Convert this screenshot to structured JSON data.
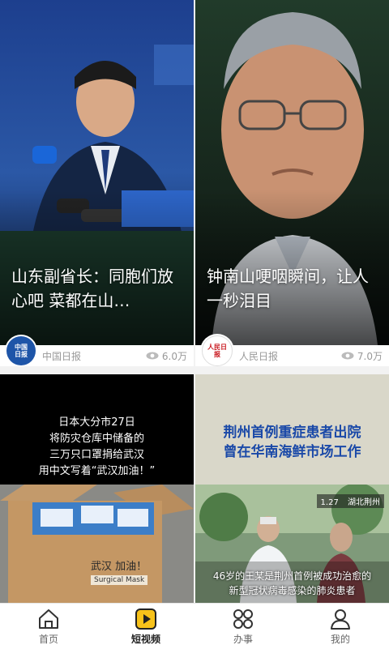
{
  "cards": [
    {
      "title": "山东副省长：同胞们放心吧 菜都在山…",
      "source": "中国日报",
      "logo_text": "中国日报",
      "views": "6.0万"
    },
    {
      "title": "钟南山哽咽瞬间，让人一秒泪目",
      "source": "人民日报",
      "logo_text": "人民日报",
      "views": "7.0万"
    },
    {
      "caption_lines": [
        "日本大分市27日",
        "将防灾仓库中储备的",
        "三万只口罩捐给武汉",
        "用中文写着“武汉加油！”"
      ],
      "box_text": "武汉 加油！",
      "box_label": "Surgical Mask"
    },
    {
      "headline_lines": [
        "荆州首例重症患者出院",
        "曾在华南海鲜市场工作"
      ],
      "date_tag": "1.27",
      "location_tag": "湖北荆州",
      "subtitle_lines": [
        "46岁的王某是荆州首例被成功治愈的",
        "新型冠状病毒感染的肺炎患者"
      ]
    }
  ],
  "tabs": [
    {
      "label": "首页",
      "icon": "home-icon"
    },
    {
      "label": "短视频",
      "icon": "short-video-icon"
    },
    {
      "label": "办事",
      "icon": "services-icon"
    },
    {
      "label": "我的",
      "icon": "profile-icon"
    }
  ],
  "colors": {
    "accent": "#f7c21a",
    "tab_active": "#222222"
  }
}
